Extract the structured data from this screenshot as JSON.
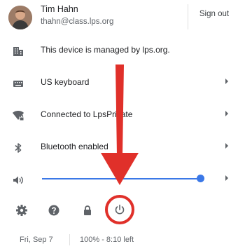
{
  "user": {
    "name": "Tim Hahn",
    "email": "thahn@class.lps.org",
    "signout_label": "Sign out"
  },
  "rows": [
    {
      "label": "This device is managed by lps.org.",
      "icon": "building-icon",
      "has_chevron": false
    },
    {
      "label": "US keyboard",
      "icon": "keyboard-icon",
      "has_chevron": true
    },
    {
      "label": "Connected to LpsPrivate",
      "icon": "wifi-lock-icon",
      "has_chevron": true
    },
    {
      "label": "Bluetooth enabled",
      "icon": "bluetooth-icon",
      "has_chevron": true
    }
  ],
  "volume": {
    "icon": "speaker-icon",
    "level": 1.0
  },
  "bottom_icons": [
    "gear-icon",
    "help-icon",
    "lock-icon",
    "power-icon"
  ],
  "status": {
    "date": "Fri, Sep 7",
    "battery": "100% - 8:10 left"
  },
  "colors": {
    "accent": "#3b78e7",
    "annotation": "#e0302a"
  }
}
